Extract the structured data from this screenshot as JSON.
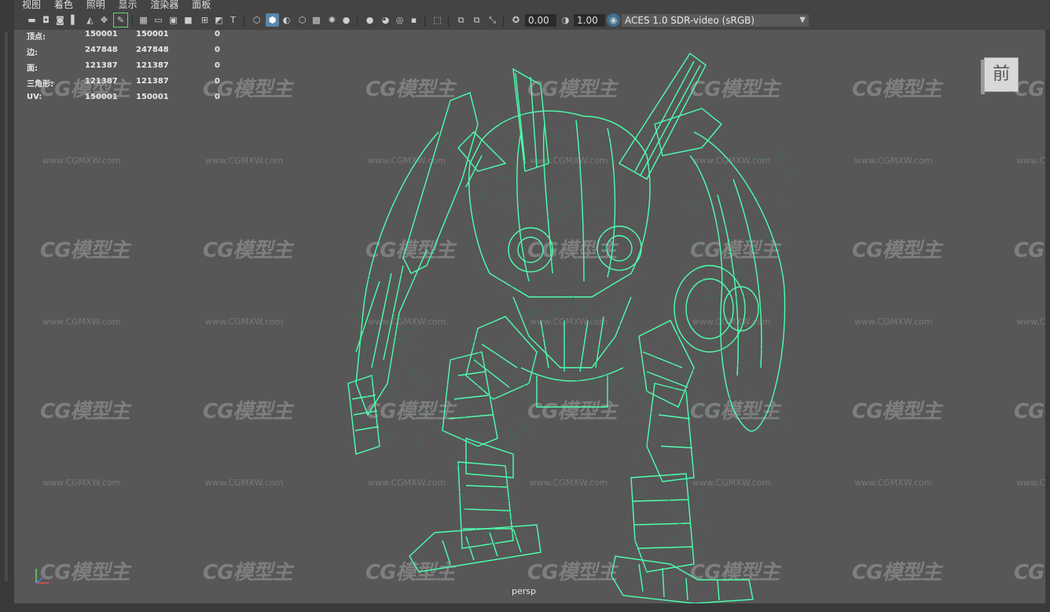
{
  "menu": [
    "视图",
    "着色",
    "照明",
    "显示",
    "渲染器",
    "面板"
  ],
  "toolbar": {
    "exposure": "0.00",
    "gamma": "1.00",
    "color_space": "ACES 1.0 SDR-video (sRGB)"
  },
  "hud": {
    "rows": [
      {
        "label": "顶点:",
        "a": "150001",
        "b": "150001",
        "c": "0"
      },
      {
        "label": "边:",
        "a": "247848",
        "b": "247848",
        "c": "0"
      },
      {
        "label": "面:",
        "a": "121387",
        "b": "121387",
        "c": "0"
      },
      {
        "label": "三角形:",
        "a": "121387",
        "b": "121387",
        "c": "0"
      },
      {
        "label": "UV:",
        "a": "150001",
        "b": "150001",
        "c": "0"
      }
    ]
  },
  "viewcube_label": "前",
  "camera_label": "persp",
  "watermark": {
    "logo": "CG模型主",
    "url": "www.CGMXW.com"
  },
  "colors": {
    "wireframe": "#4dffb0",
    "viewport_bg": "#575757",
    "ui_bg": "#444444",
    "accent": "#5a86a8"
  }
}
